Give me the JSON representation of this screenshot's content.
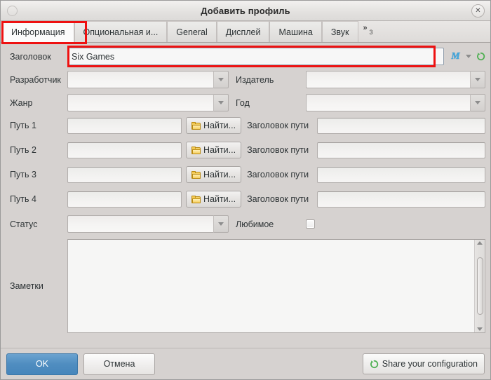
{
  "window": {
    "title": "Добавить профиль",
    "close_label": "✕",
    "left_dot": "window-menu-dot"
  },
  "tabs": [
    {
      "label": "Информация",
      "active": true
    },
    {
      "label": "Опциональная и...",
      "active": false
    },
    {
      "label": "General",
      "active": false
    },
    {
      "label": "Дисплей",
      "active": false
    },
    {
      "label": "Машина",
      "active": false
    },
    {
      "label": "Звук",
      "active": false
    }
  ],
  "tab_overflow": {
    "chevron": "»",
    "count": "3"
  },
  "form": {
    "title": {
      "label": "Заголовок",
      "value": "Six Games",
      "placeholder": ""
    },
    "title_tools": {
      "moby_icon": "M",
      "dropdown_icon": "chevron-down-icon",
      "refresh_icon": "refresh-icon"
    },
    "developer": {
      "label": "Разработчик",
      "value": ""
    },
    "publisher": {
      "label": "Издатель",
      "value": ""
    },
    "genre": {
      "label": "Жанр",
      "value": ""
    },
    "year": {
      "label": "Год",
      "value": ""
    },
    "browse_label": "Найти...",
    "path_title_label": "Заголовок пути",
    "paths": [
      {
        "label": "Путь 1",
        "value": "",
        "title_value": ""
      },
      {
        "label": "Путь 2",
        "value": "",
        "title_value": ""
      },
      {
        "label": "Путь 3",
        "value": "",
        "title_value": ""
      },
      {
        "label": "Путь 4",
        "value": "",
        "title_value": ""
      }
    ],
    "status": {
      "label": "Статус",
      "value": ""
    },
    "favorite": {
      "label": "Любимое",
      "checked": false
    },
    "notes": {
      "label": "Заметки",
      "value": ""
    }
  },
  "actions": {
    "ok": "OK",
    "cancel": "Отмена",
    "share": "Share your configuration"
  },
  "colors": {
    "accent_blue": "#4f8dc0",
    "annotation_red": "#ee1111",
    "moby_blue": "#3fa9e0",
    "sync_green": "#4caf50",
    "window_bg": "#d6d2d0"
  }
}
